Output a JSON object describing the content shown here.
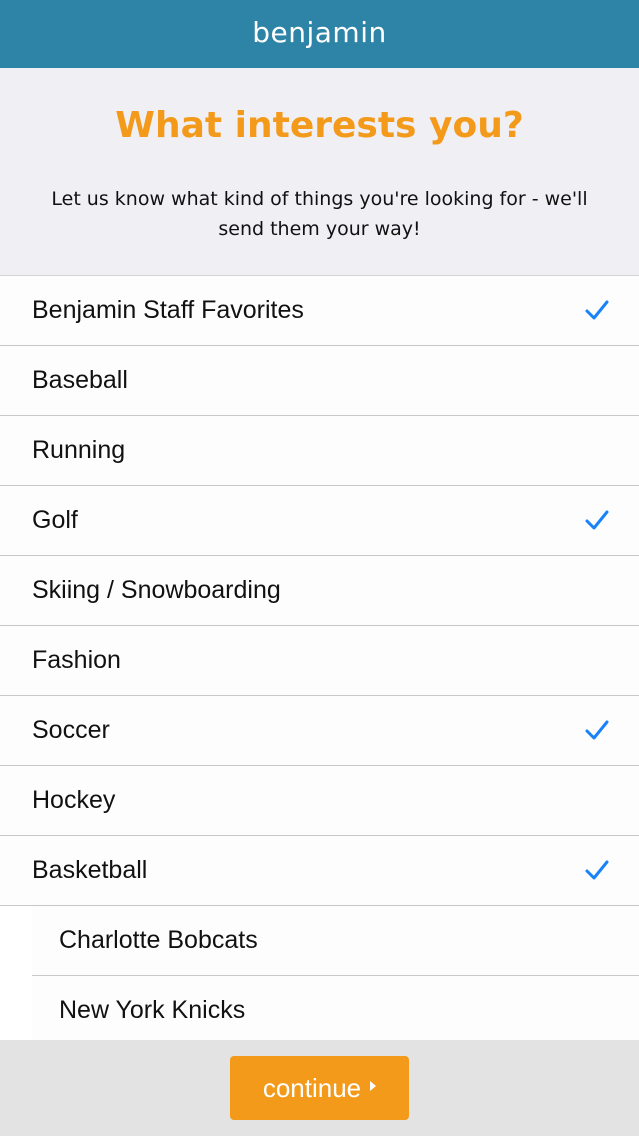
{
  "app": {
    "logo": "benjamin"
  },
  "header": {
    "title": "What interests you?",
    "subtitle": "Let us know what kind of things you're looking for - we'll send them your way!"
  },
  "interests": [
    {
      "label": "Benjamin Staff Favorites",
      "checked": true,
      "sub": false
    },
    {
      "label": "Baseball",
      "checked": false,
      "sub": false
    },
    {
      "label": "Running",
      "checked": false,
      "sub": false
    },
    {
      "label": "Golf",
      "checked": true,
      "sub": false
    },
    {
      "label": "Skiing / Snowboarding",
      "checked": false,
      "sub": false
    },
    {
      "label": "Fashion",
      "checked": false,
      "sub": false
    },
    {
      "label": "Soccer",
      "checked": true,
      "sub": false
    },
    {
      "label": "Hockey",
      "checked": false,
      "sub": false
    },
    {
      "label": "Basketball",
      "checked": true,
      "sub": false
    },
    {
      "label": "Charlotte Bobcats",
      "checked": false,
      "sub": true
    },
    {
      "label": "New York Knicks",
      "checked": false,
      "sub": true
    }
  ],
  "footer": {
    "continue_label": "continue"
  },
  "colors": {
    "nav_bar": "#2e84a6",
    "accent_orange": "#f39a1b",
    "checkmark_blue": "#1a82f7"
  },
  "icons": {
    "checkmark": "checkmark-icon",
    "continue_arrow": "caret-right-icon"
  }
}
